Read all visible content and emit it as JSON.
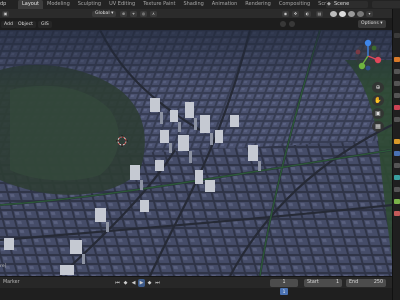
{
  "topbar": {
    "menu_left": "dp",
    "tabs": [
      "Layout",
      "Modeling",
      "Sculpting",
      "UV Editing",
      "Texture Paint",
      "Shading",
      "Animation",
      "Rendering",
      "Compositing",
      "Scripting"
    ],
    "active_tab": "Layout",
    "add_tab": "+",
    "scene_label": "Scene"
  },
  "header": {
    "mode_add": "Add",
    "mode_object": "Object",
    "gis": "GIS",
    "orientation": "Global",
    "options": "Options"
  },
  "viewport": {
    "left_edge_text": "re]",
    "accent_colors": {
      "x_axis": "#e0475a",
      "y_axis": "#6fb43f",
      "z_axis": "#3f86e8",
      "building": "#cfd3dc",
      "road": "#454b5c",
      "park": "#3a4a3a"
    }
  },
  "timeline": {
    "marker_label": "Marker",
    "current_frame": "1",
    "start_label": "Start",
    "start_value": "1",
    "end_label": "End",
    "end_value": "250"
  }
}
